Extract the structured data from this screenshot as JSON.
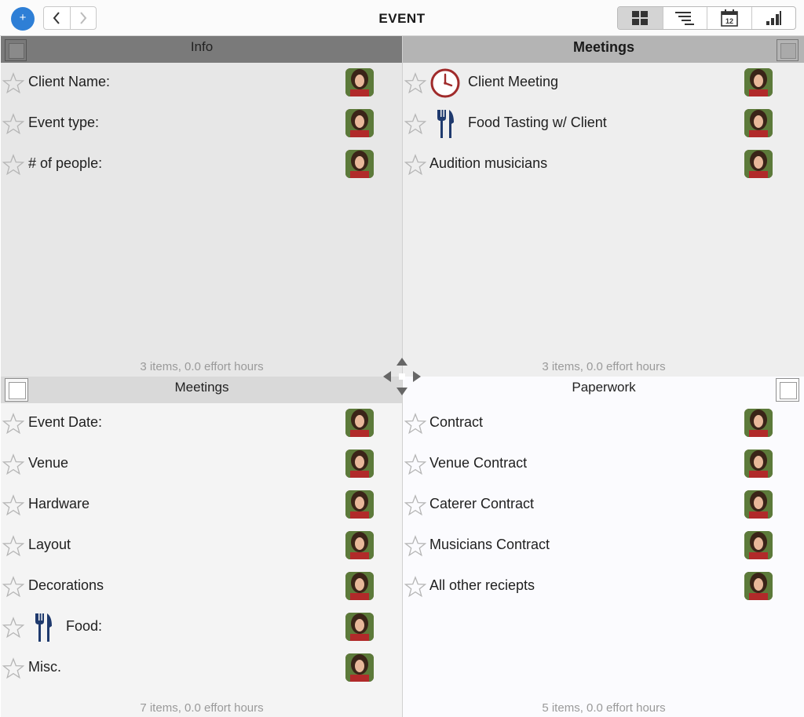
{
  "window": {
    "title": "EVENT"
  },
  "toolbar": {
    "add_label": "+",
    "back_icon": "chevron-left-icon",
    "forward_icon": "chevron-right-icon",
    "views": [
      {
        "icon": "grid-view-icon",
        "active": true
      },
      {
        "icon": "outline-view-icon",
        "active": false
      },
      {
        "icon": "calendar-view-icon",
        "active": false,
        "text": "12"
      },
      {
        "icon": "bar-view-icon",
        "active": false
      }
    ]
  },
  "quadrants": {
    "top_left": {
      "title": "Info",
      "summary": "3 items, 0.0 effort hours",
      "tasks": [
        {
          "label": "Client Name:"
        },
        {
          "label": "Event type:"
        },
        {
          "label": "# of people:"
        }
      ]
    },
    "top_right": {
      "title": "Meetings",
      "summary": "3 items, 0.0 effort hours",
      "tasks": [
        {
          "label": "Client Meeting",
          "icon": "clock-icon"
        },
        {
          "label": "Food Tasting w/ Client",
          "icon": "fork-knife-icon"
        },
        {
          "label": "Audition musicians"
        }
      ]
    },
    "bottom_left": {
      "title": "Meetings",
      "summary": "7 items, 0.0 effort hours",
      "tasks": [
        {
          "label": "Event Date:"
        },
        {
          "label": "Venue"
        },
        {
          "label": "Hardware"
        },
        {
          "label": "Layout"
        },
        {
          "label": "Decorations"
        },
        {
          "label": "Food:",
          "icon": "fork-knife-icon"
        },
        {
          "label": "Misc."
        }
      ]
    },
    "bottom_right": {
      "title": "Paperwork",
      "summary": "5 items, 0.0 effort hours",
      "tasks": [
        {
          "label": "Contract"
        },
        {
          "label": "Venue Contract"
        },
        {
          "label": "Caterer Contract"
        },
        {
          "label": "Musicians Contract"
        },
        {
          "label": "All other reciepts"
        }
      ]
    }
  }
}
